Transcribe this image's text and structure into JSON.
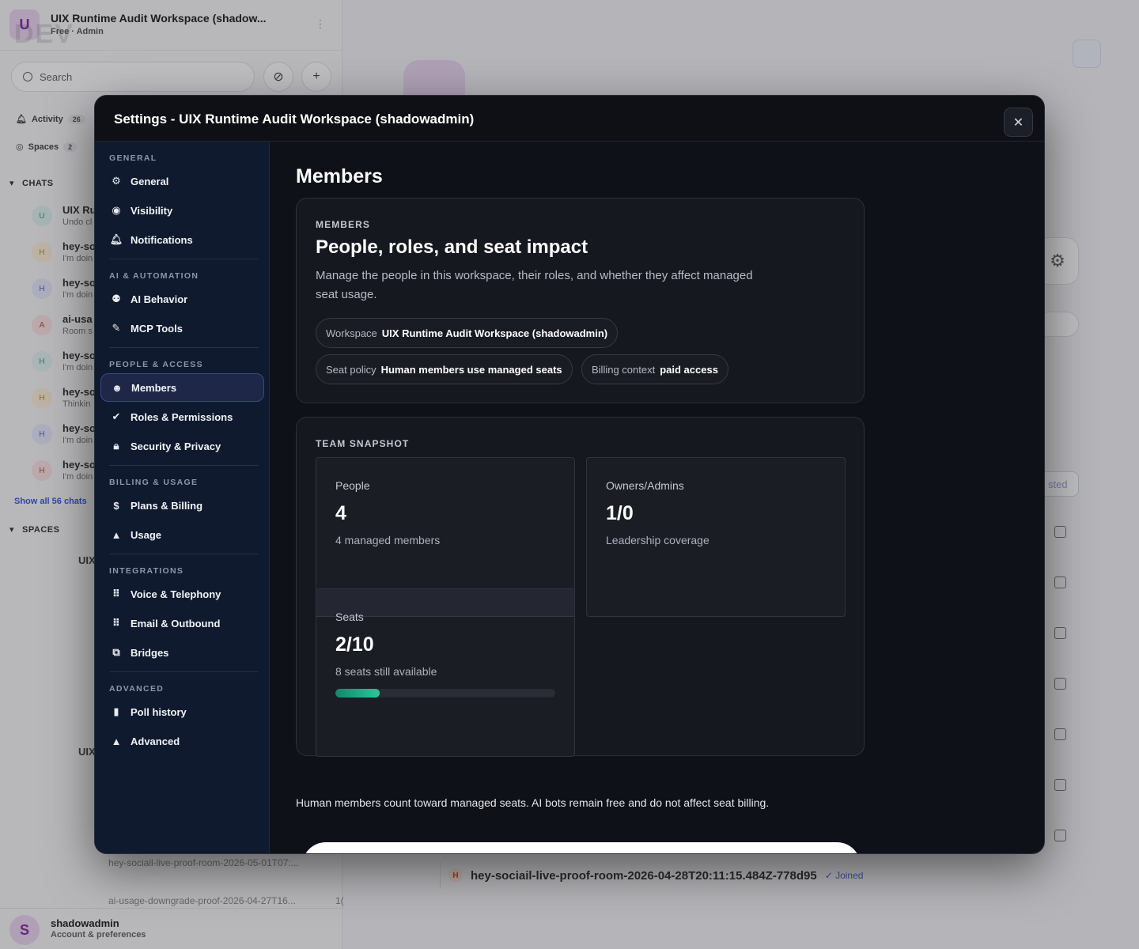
{
  "workspace": {
    "avatar_letter": "U",
    "env_badge": "DEV",
    "name": "UIX Runtime Audit Workspace (shadow...",
    "plan": "Free · Admin",
    "menu_glyph": "⋮"
  },
  "search": {
    "placeholder": "Search"
  },
  "nav": {
    "activity_label": "Activity",
    "activity_count": "26",
    "spaces_label": "Spaces",
    "spaces_count": "2"
  },
  "chats": {
    "header": "CHATS",
    "items": [
      {
        "letter": "U",
        "title": "UIX Ru",
        "snippet": "Undo cl"
      },
      {
        "letter": "H",
        "title": "hey-so",
        "snippet": "I'm doin"
      },
      {
        "letter": "H",
        "title": "hey-so",
        "snippet": "I'm doin"
      },
      {
        "letter": "A",
        "title": "ai-usa",
        "snippet": "Room s"
      },
      {
        "letter": "H",
        "title": "hey-so",
        "snippet": "I'm doin"
      },
      {
        "letter": "H",
        "title": "hey-so",
        "snippet": "Thinkin"
      },
      {
        "letter": "H",
        "title": "hey-so",
        "snippet": "I'm doin"
      },
      {
        "letter": "H",
        "title": "hey-so",
        "snippet": "I'm doin"
      }
    ],
    "show_all": "Show all 56 chats"
  },
  "spaces": {
    "header": "SPACES",
    "space_1": "UIX",
    "space_2": "UIX",
    "room_a": "hey-sociail-live-proof-room-2026-05-01T07:...",
    "room_b": "ai-usage-downgrade-proof-2026-04-27T16...",
    "room_b_suffix": "1("
  },
  "user": {
    "avatar_letter": "S",
    "name": "shadowadmin",
    "subtitle": "Account & preferences"
  },
  "background": {
    "room_letter": "H",
    "room_title": "hey-sociail-live-proof-room-2026-04-28T20:11:15.484Z-778d95",
    "room_status": "✓ Joined",
    "pill_fragment": "sted",
    "gear_glyph": "⚙"
  },
  "modal": {
    "title": "Settings - UIX Runtime Audit Workspace (shadowadmin)",
    "close_glyph": "✕",
    "sidebar": {
      "groups": [
        {
          "label": "GENERAL",
          "items": [
            {
              "id": "general",
              "label": "General",
              "icon": "⚙",
              "icon_name": "gear-icon"
            },
            {
              "id": "visibility",
              "label": "Visibility",
              "icon": "◉",
              "icon_name": "eye-icon"
            },
            {
              "id": "notifications",
              "label": "Notifications",
              "icon": "🔔︎",
              "icon_name": "bell-icon"
            }
          ]
        },
        {
          "label": "AI & AUTOMATION",
          "items": [
            {
              "id": "ai-behavior",
              "label": "AI Behavior",
              "icon": "⚉",
              "icon_name": "robot-icon"
            },
            {
              "id": "mcp-tools",
              "label": "MCP Tools",
              "icon": "✎",
              "icon_name": "pencil-icon"
            }
          ]
        },
        {
          "label": "PEOPLE & ACCESS",
          "items": [
            {
              "id": "members",
              "label": "Members",
              "icon": "☻",
              "icon_name": "members-icon",
              "active": true
            },
            {
              "id": "roles",
              "label": "Roles & Permissions",
              "icon": "✔",
              "icon_name": "badge-check-icon"
            },
            {
              "id": "security",
              "label": "Security & Privacy",
              "icon": "🔒︎",
              "icon_name": "lock-icon"
            }
          ]
        },
        {
          "label": "BILLING & USAGE",
          "items": [
            {
              "id": "plans",
              "label": "Plans & Billing",
              "icon": "$",
              "icon_name": "invoice-icon"
            },
            {
              "id": "usage",
              "label": "Usage",
              "icon": "▲",
              "icon_name": "warning-icon"
            }
          ]
        },
        {
          "label": "INTEGRATIONS",
          "items": [
            {
              "id": "voice",
              "label": "Voice & Telephony",
              "icon": "⠿",
              "icon_name": "dial-grid-icon"
            },
            {
              "id": "email",
              "label": "Email & Outbound",
              "icon": "⠿",
              "icon_name": "dial-grid-icon"
            },
            {
              "id": "bridges",
              "label": "Bridges",
              "icon": "⧉",
              "icon_name": "bridge-icon"
            }
          ]
        },
        {
          "label": "ADVANCED",
          "items": [
            {
              "id": "poll",
              "label": "Poll history",
              "icon": "▮",
              "icon_name": "bar-chart-icon"
            },
            {
              "id": "advanced",
              "label": "Advanced",
              "icon": "▲",
              "icon_name": "warning-icon"
            }
          ]
        }
      ]
    },
    "page_title": "Members",
    "members_card": {
      "eyebrow": "MEMBERS",
      "heading": "People, roles, and seat impact",
      "description": "Manage the people in this workspace, their roles, and whether they affect managed seat usage.",
      "chips": [
        {
          "key": "Workspace",
          "value": "UIX Runtime Audit Workspace (shadowadmin)"
        },
        {
          "key": "Seat policy",
          "value": "Human members use managed seats"
        },
        {
          "key": "Billing context",
          "value": "paid access"
        }
      ]
    },
    "snapshot": {
      "eyebrow": "TEAM SNAPSHOT",
      "people": {
        "label": "People",
        "value": "4",
        "sub": "4 managed members"
      },
      "owners": {
        "label": "Owners/Admins",
        "value": "1/0",
        "sub": "Leadership coverage"
      },
      "seats": {
        "label": "Seats",
        "value": "2/10",
        "sub": "8 seats still available",
        "used": 2,
        "total": 10
      }
    },
    "note": "Human members count toward managed seats. AI bots remain free and do not affect seat billing."
  }
}
